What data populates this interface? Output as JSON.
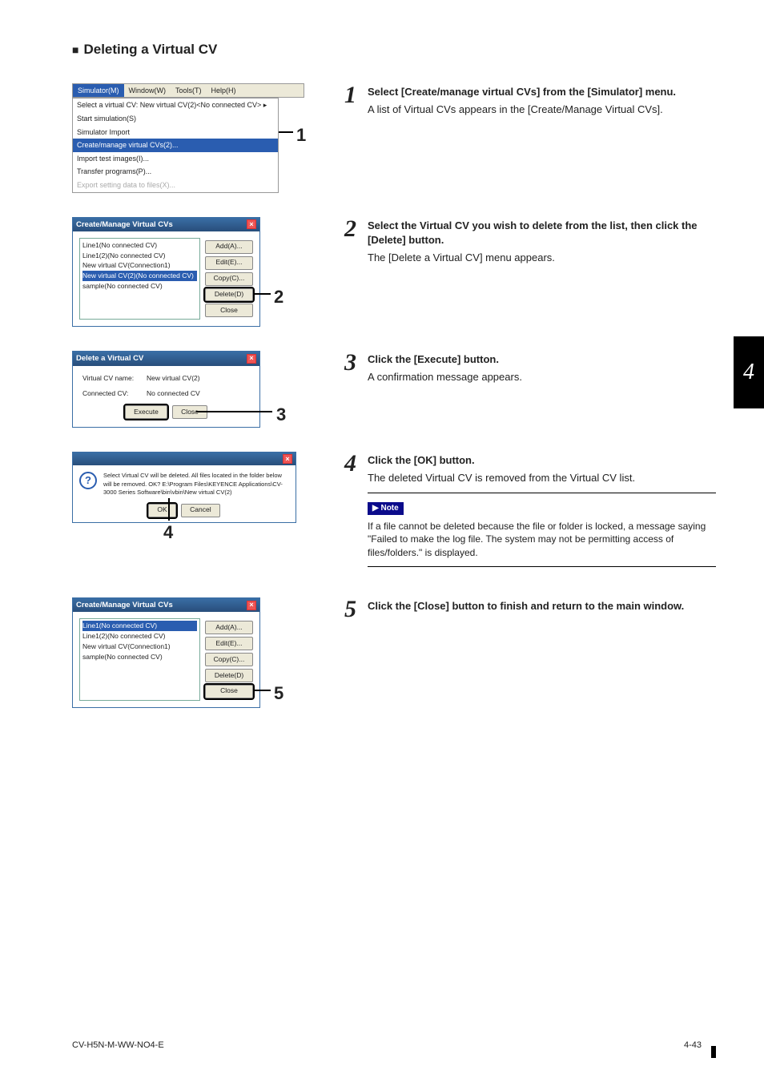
{
  "heading": "Deleting a Virtual CV",
  "steps": [
    {
      "n": "1",
      "title": "Select [Create/manage virtual CVs] from the [Simulator] menu.",
      "body": "A list of Virtual CVs appears in the [Create/Manage Virtual CVs]."
    },
    {
      "n": "2",
      "title": "Select the Virtual CV you wish to delete from the list, then click the [Delete] button.",
      "body": "The [Delete a Virtual CV] menu appears."
    },
    {
      "n": "3",
      "title": "Click the [Execute] button.",
      "body": "A confirmation message appears."
    },
    {
      "n": "4",
      "title": "Click the [OK] button.",
      "body": "The deleted Virtual CV is removed from the Virtual CV list."
    },
    {
      "n": "5",
      "title": "Click the [Close] button to finish and return to the main window.",
      "body": ""
    }
  ],
  "note": {
    "label": "▶ Note",
    "text": "If a file cannot be deleted because the file or folder is locked, a message saying \"Failed to make the log file. The system may not be permitting access of files/folders.\" is displayed."
  },
  "sidetab": "4",
  "footer": {
    "left": "CV-H5N-M-WW-NO4-E",
    "right": "4-43"
  },
  "shot1": {
    "menubar": {
      "items": [
        "Simulator(M)",
        "Window(W)",
        "Tools(T)",
        "Help(H)"
      ]
    },
    "dropdown": {
      "items": [
        "Select a virtual CV:  New virtual CV(2)<No connected CV>   ▸",
        "Start simulation(S)",
        "Simulator Import",
        "Create/manage virtual CVs(2)...",
        "Import test images(I)...",
        "Transfer programs(P)...",
        "Export setting data to files(X)..."
      ],
      "selIndex": 3,
      "disIndex": 6
    }
  },
  "shot2": {
    "title": "Create/Manage Virtual CVs",
    "list": [
      "Line1(No connected CV)",
      "Line1(2)(No connected CV)",
      "New virtual CV(Connection1)",
      "New virtual CV(2)(No connected CV)",
      "sample(No connected CV)"
    ],
    "selIndex": 3,
    "buttons": [
      "Add(A)...",
      "Edit(E)...",
      "Copy(C)...",
      "Delete(D)",
      "Close"
    ]
  },
  "shot3": {
    "title": "Delete a Virtual CV",
    "rows": [
      {
        "lab": "Virtual CV name:",
        "val": "New virtual CV(2)"
      },
      {
        "lab": "Connected CV:",
        "val": "No connected CV"
      }
    ],
    "buttons": [
      "Execute",
      "Close"
    ]
  },
  "shot4": {
    "msg": "Select Virtual CV will be deleted. All files located in the folder below will be removed. OK?\nE:\\Program Files\\KEYENCE Applications\\CV-3000 Series Software\\bin\\vbin\\New virtual CV(2)",
    "buttons": [
      "OK",
      "Cancel"
    ]
  },
  "shot5": {
    "title": "Create/Manage Virtual CVs",
    "list": [
      "Line1(No connected CV)",
      "Line1(2)(No connected CV)",
      "New virtual CV(Connection1)",
      "sample(No connected CV)"
    ],
    "selIndex": 0,
    "buttons": [
      "Add(A)...",
      "Edit(E)...",
      "Copy(C)...",
      "Delete(D)",
      "Close"
    ]
  }
}
